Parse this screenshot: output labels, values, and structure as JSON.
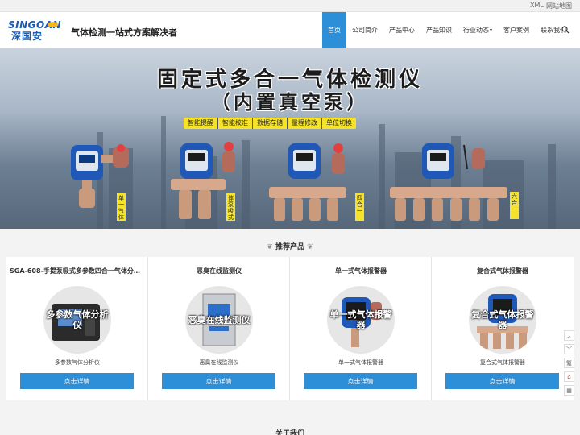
{
  "topbar": {
    "xml": "XML",
    "sitemap": "网站地图"
  },
  "header": {
    "logo_en": "SINGOAN",
    "logo_cn": "深国安",
    "slogan": "气体检测一站式方案解决者"
  },
  "nav": {
    "items": [
      {
        "label": "首页",
        "active": true
      },
      {
        "label": "公司简介"
      },
      {
        "label": "产品中心"
      },
      {
        "label": "产品知识"
      },
      {
        "label": "行业动态",
        "dropdown": true
      },
      {
        "label": "客户案例"
      },
      {
        "label": "联系我们"
      }
    ],
    "search_icon": "search-icon"
  },
  "banner": {
    "title_line1": "固定式多合一气体检测仪",
    "title_line2": "（内置真空泵）",
    "features": [
      "智能提醒",
      "智能校准",
      "数据存储",
      "量程修改",
      "单位切换"
    ],
    "labels": [
      "单一气体",
      "体泵吸式",
      "四合一",
      "六合一"
    ]
  },
  "recommend": {
    "title": "推荐产品",
    "icon": "leaf-icon",
    "products": [
      {
        "title": "SGA-608-手提泵吸式多参数四合一气体分析仪",
        "overlay": "多参数气体分析仪",
        "caption": "多参数气体分析仪",
        "button": "点击详情"
      },
      {
        "title": "恶臭在线监测仪",
        "overlay": "恶臭在线监测仪",
        "caption": "恶臭在线监测仪",
        "button": "点击详情"
      },
      {
        "title": "单一式气体报警器",
        "overlay": "单一式气体报警器",
        "caption": "单一式气体报警器",
        "button": "点击详情"
      },
      {
        "title": "复合式气体报警器",
        "overlay": "复合式气体报警器",
        "caption": "复合式气体报警器",
        "button": "点击详情"
      }
    ]
  },
  "side_tools": [
    "︿",
    "﹀",
    "繁",
    "⌂",
    "▦"
  ],
  "about": {
    "title": "关于我们"
  },
  "colors": {
    "accent": "#2d8fd8",
    "brand": "#1a5db3",
    "highlight": "#f5e22a"
  }
}
